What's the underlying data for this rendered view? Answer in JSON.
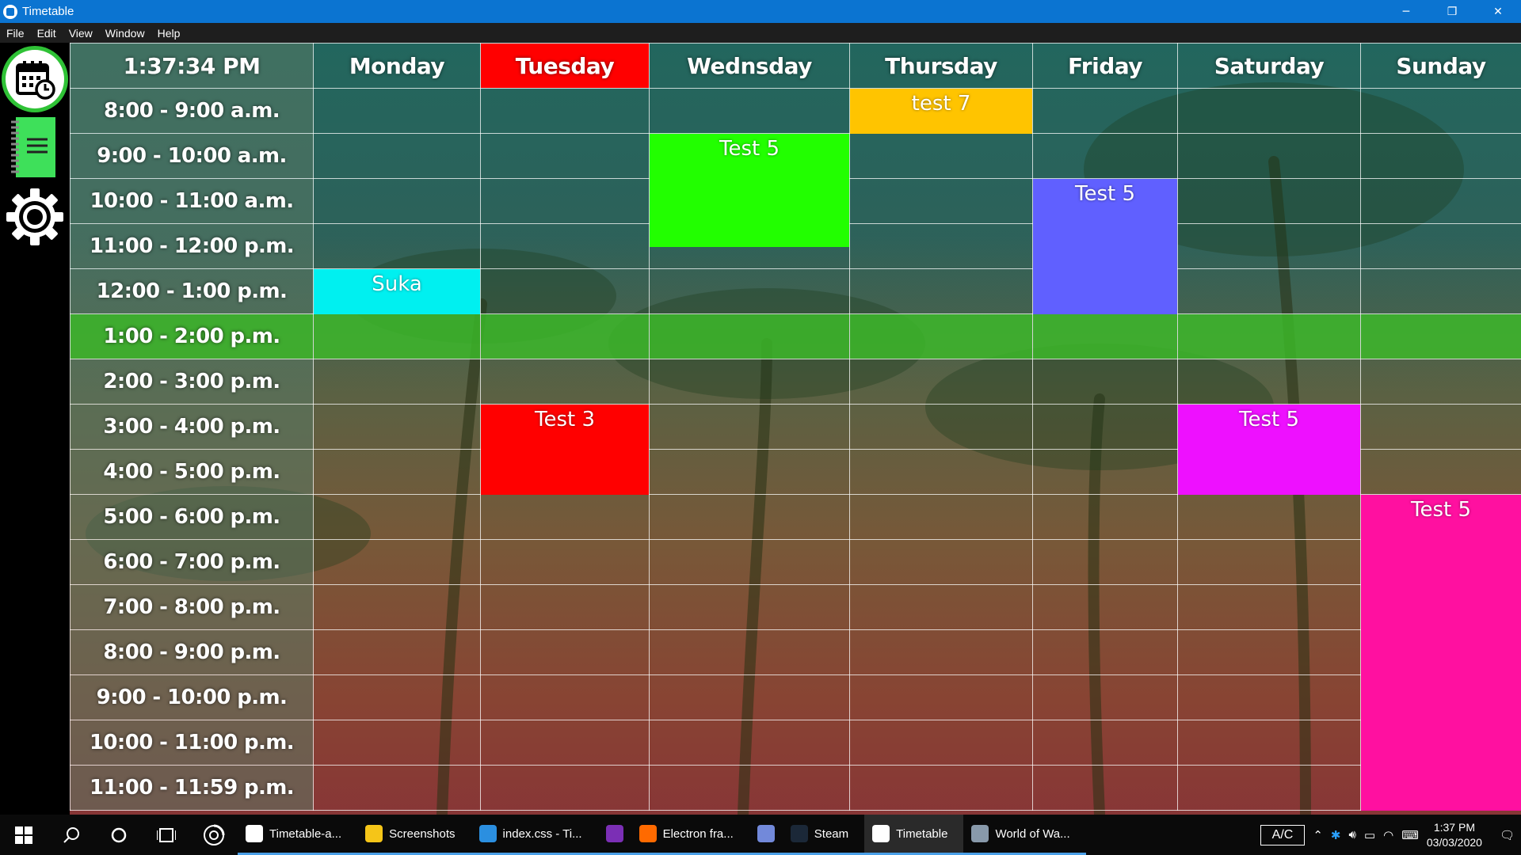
{
  "window": {
    "title": "Timetable",
    "minimize": "─",
    "restore": "❐",
    "close": "✕"
  },
  "menu": [
    "File",
    "Edit",
    "View",
    "Window",
    "Help"
  ],
  "sidebar": {
    "items": [
      "calendar-icon",
      "notebook-icon",
      "gear-icon"
    ]
  },
  "grid": {
    "clock": "1:37:34 PM",
    "days": [
      "Monday",
      "Tuesday",
      "Wednsday",
      "Thursday",
      "Friday",
      "Saturday",
      "Sunday"
    ],
    "today_index": 1,
    "current_slot_index": 5,
    "times": [
      "8:00 - 9:00 a.m.",
      "9:00 - 10:00 a.m.",
      "10:00 - 11:00 a.m.",
      "11:00 - 12:00 p.m.",
      "12:00 - 1:00 p.m.",
      "1:00 - 2:00 p.m.",
      "2:00 - 3:00 p.m.",
      "3:00 - 4:00 p.m.",
      "4:00 - 5:00 p.m.",
      "5:00 - 6:00 p.m.",
      "6:00 - 7:00 p.m.",
      "7:00 - 8:00 p.m.",
      "8:00 - 9:00 p.m.",
      "9:00 - 10:00 p.m.",
      "10:00 - 11:00 p.m.",
      "11:00 - 11:59 p.m."
    ],
    "events": [
      {
        "label": "Suka",
        "day": 0,
        "start": 4,
        "span": 1,
        "color": "#00f0f0"
      },
      {
        "label": "Test 3",
        "day": 1,
        "start": 7,
        "span": 2,
        "color": "#ff0000"
      },
      {
        "label": "Test 5",
        "day": 2,
        "start": 1,
        "span": 2.5,
        "color": "#22ff00"
      },
      {
        "label": "test 7",
        "day": 3,
        "start": 0,
        "span": 1,
        "color": "#ffc400"
      },
      {
        "label": "Test 5",
        "day": 4,
        "start": 2,
        "span": 3,
        "color": "#6060ff"
      },
      {
        "label": "Test 5",
        "day": 5,
        "start": 7,
        "span": 2,
        "color": "#ee10ff"
      },
      {
        "label": "Test 5",
        "day": 6,
        "start": 9,
        "span": 7,
        "color": "#ff10a0"
      }
    ]
  },
  "taskbar": {
    "apps": [
      {
        "label": "Timetable-a...",
        "icon": "timetable-icon",
        "color": "#ffffff"
      },
      {
        "label": "Screenshots",
        "icon": "folder-icon",
        "color": "#f5c518"
      },
      {
        "label": "index.css - Ti...",
        "icon": "vscode-icon",
        "color": "#2b8fe0"
      },
      {
        "label": "",
        "icon": "onenote-icon",
        "color": "#7b2fb5"
      },
      {
        "label": "Electron fra...",
        "icon": "firefox-icon",
        "color": "#ff6a00"
      },
      {
        "label": "",
        "icon": "discord-icon",
        "color": "#7289da"
      },
      {
        "label": "Steam",
        "icon": "steam-icon",
        "color": "#1b2838"
      },
      {
        "label": "Timetable",
        "icon": "timetable-icon",
        "color": "#ffffff"
      },
      {
        "label": "World of Wa...",
        "icon": "wows-icon",
        "color": "#8899aa"
      }
    ],
    "ac": "A/C",
    "time": "1:37 PM",
    "date": "03/03/2020"
  }
}
